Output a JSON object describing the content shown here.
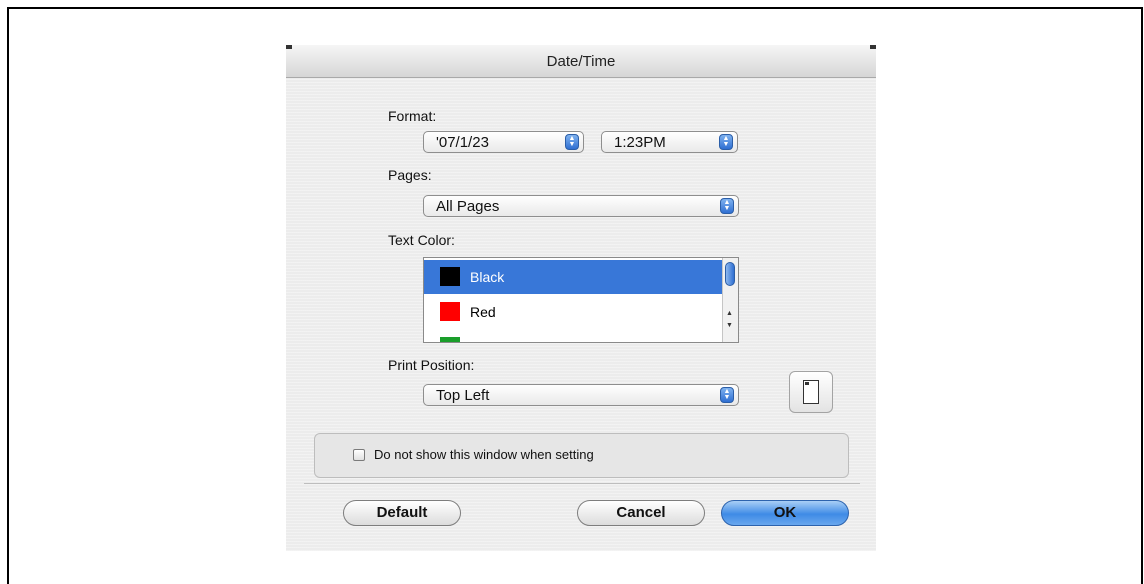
{
  "dialog": {
    "title": "Date/Time",
    "format_label": "Format:",
    "date_format": "'07/1/23",
    "time_format": "1:23PM",
    "pages_label": "Pages:",
    "pages_value": "All Pages",
    "text_color_label": "Text Color:",
    "colors": [
      {
        "name": "Black",
        "swatch": "#000000",
        "selected": true
      },
      {
        "name": "Red",
        "swatch": "#ff0000",
        "selected": false
      },
      {
        "name": "",
        "swatch": "#1a9e2a",
        "selected": false
      }
    ],
    "print_position_label": "Print Position:",
    "print_position_value": "Top Left",
    "dont_show_label": "Do not show this window when setting",
    "default_label": "Default",
    "cancel_label": "Cancel",
    "ok_label": "OK"
  },
  "icons": {
    "popup_arrows": "up-down-arrows-icon",
    "print_position": "page-position-icon",
    "scroll_up": "scroll-up-arrow-icon",
    "scroll_down": "scroll-down-arrow-icon"
  },
  "colors": {
    "selection": "#3877d8",
    "ok_button": "#3f8be6",
    "dialog_background": "#ececec"
  }
}
